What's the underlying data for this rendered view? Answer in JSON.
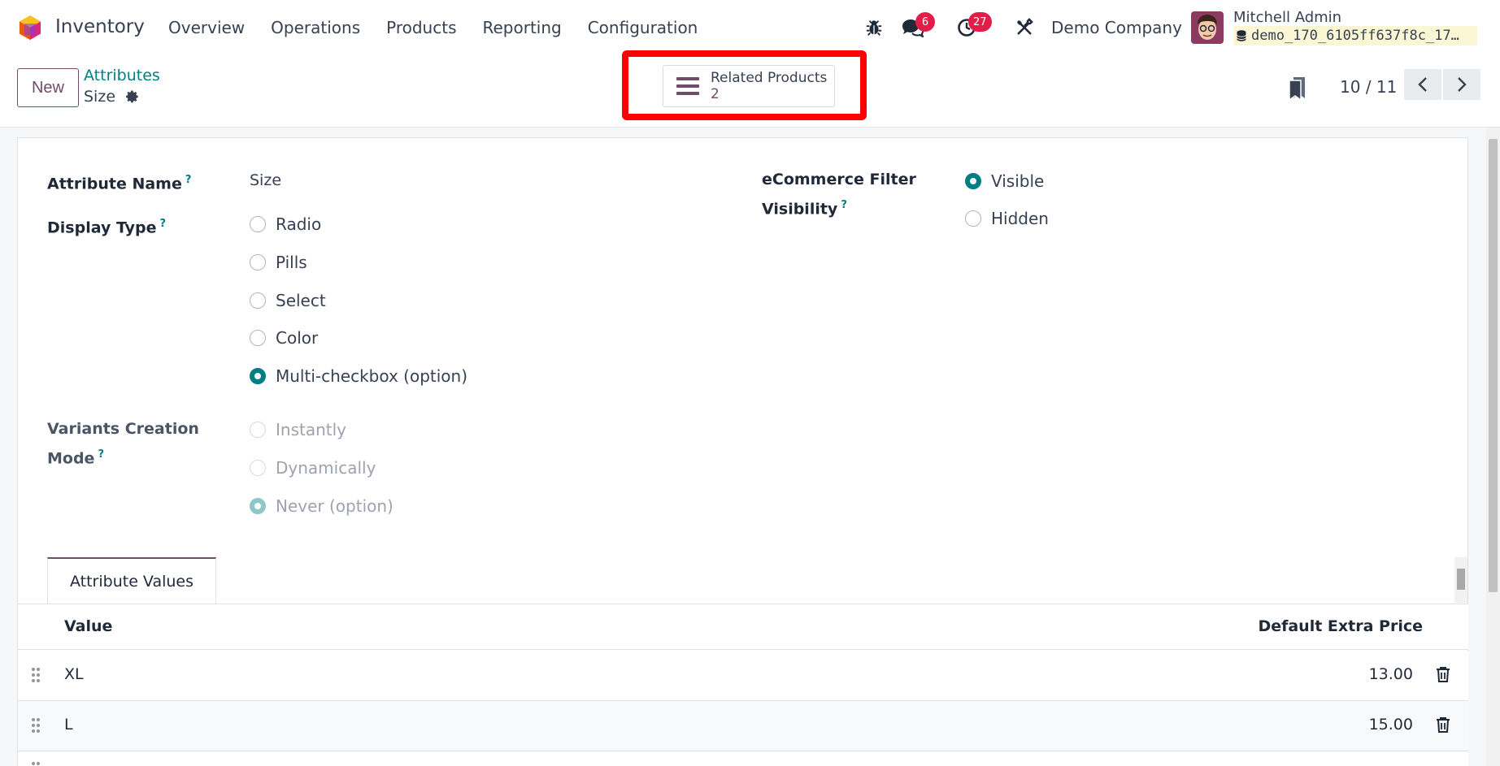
{
  "navbar": {
    "app_name": "Inventory",
    "menu": [
      "Overview",
      "Operations",
      "Products",
      "Reporting",
      "Configuration"
    ],
    "messages_count": "6",
    "activities_count": "27",
    "company": "Demo Company",
    "user_name": "Mitchell Admin",
    "database": "demo_170_6105ff637f8c_17…"
  },
  "control": {
    "new_label": "New",
    "breadcrumb_parent": "Attributes",
    "breadcrumb_current": "Size",
    "related_label": "Related Products",
    "related_count": "2",
    "pager": "10 / 11"
  },
  "form": {
    "attribute_name_label": "Attribute Name",
    "attribute_name_value": "Size",
    "help_mark": "?",
    "display_type_label": "Display Type",
    "display_type_options": [
      "Radio",
      "Pills",
      "Select",
      "Color",
      "Multi-checkbox (option)"
    ],
    "display_type_selected": "Multi-checkbox (option)",
    "variants_label_line1": "Variants Creation",
    "variants_label_line2": "Mode",
    "variants_options": [
      "Instantly",
      "Dynamically",
      "Never (option)"
    ],
    "variants_selected": "Never (option)",
    "ecommerce_label_line1": "eCommerce Filter",
    "ecommerce_label_line2": "Visibility",
    "ecommerce_options": [
      "Visible",
      "Hidden"
    ],
    "ecommerce_selected": "Visible"
  },
  "values_tab": {
    "tab_label": "Attribute Values",
    "col_value": "Value",
    "col_price": "Default Extra Price",
    "rows": [
      {
        "value": "XL",
        "price": "13.00"
      },
      {
        "value": "L",
        "price": "15.00"
      }
    ]
  },
  "colors": {
    "brand": "#714b67",
    "accent": "#017e84",
    "badge": "#e11d48",
    "highlight": "#ff0000"
  },
  "icons": [
    "odoo-logo",
    "bug-icon",
    "chat-icon",
    "clock-icon",
    "tools-icon",
    "database-icon",
    "gear-icon",
    "list-icon",
    "bookmark-icon",
    "chevron-left-icon",
    "chevron-right-icon",
    "drag-handle-icon",
    "trash-icon"
  ]
}
